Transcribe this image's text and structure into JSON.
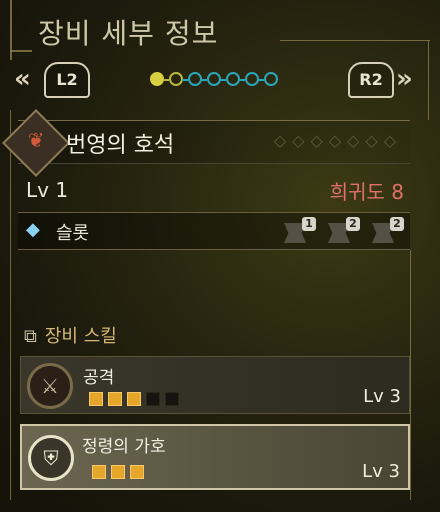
{
  "header": {
    "title": "장비 세부 정보"
  },
  "nav": {
    "prev_chevron": "«",
    "next_chevron": "»",
    "left_trigger": "L2",
    "right_trigger": "R2",
    "pages": [
      {
        "active": true,
        "color": "#d8d040"
      },
      {
        "active": false,
        "color": "#b8b83a"
      },
      {
        "active": false,
        "color": "#2aa6b8"
      },
      {
        "active": false,
        "color": "#2aa6b8"
      },
      {
        "active": false,
        "color": "#2aa6b8"
      },
      {
        "active": false,
        "color": "#2aa6b8"
      },
      {
        "active": false,
        "color": "#2aa6b8"
      }
    ]
  },
  "item": {
    "name": "번영의 호석",
    "level": "Lv 1",
    "rarity": "희귀도 8",
    "rarity_color": "#e0706a",
    "icon": "charm-icon"
  },
  "slots": {
    "label": "슬롯",
    "icon": "gem-icon",
    "slot_levels": [
      "1",
      "2",
      "2"
    ]
  },
  "skills_section": {
    "title": "장비 스킬",
    "skills": [
      {
        "name": "공격",
        "level": "Lv 3",
        "filled": 3,
        "total": 5,
        "icon": "sword-icon"
      },
      {
        "name": "정령의 가호",
        "level": "Lv 3",
        "filled": 3,
        "total": 3,
        "icon": "shield-icon",
        "selected": true
      }
    ]
  }
}
